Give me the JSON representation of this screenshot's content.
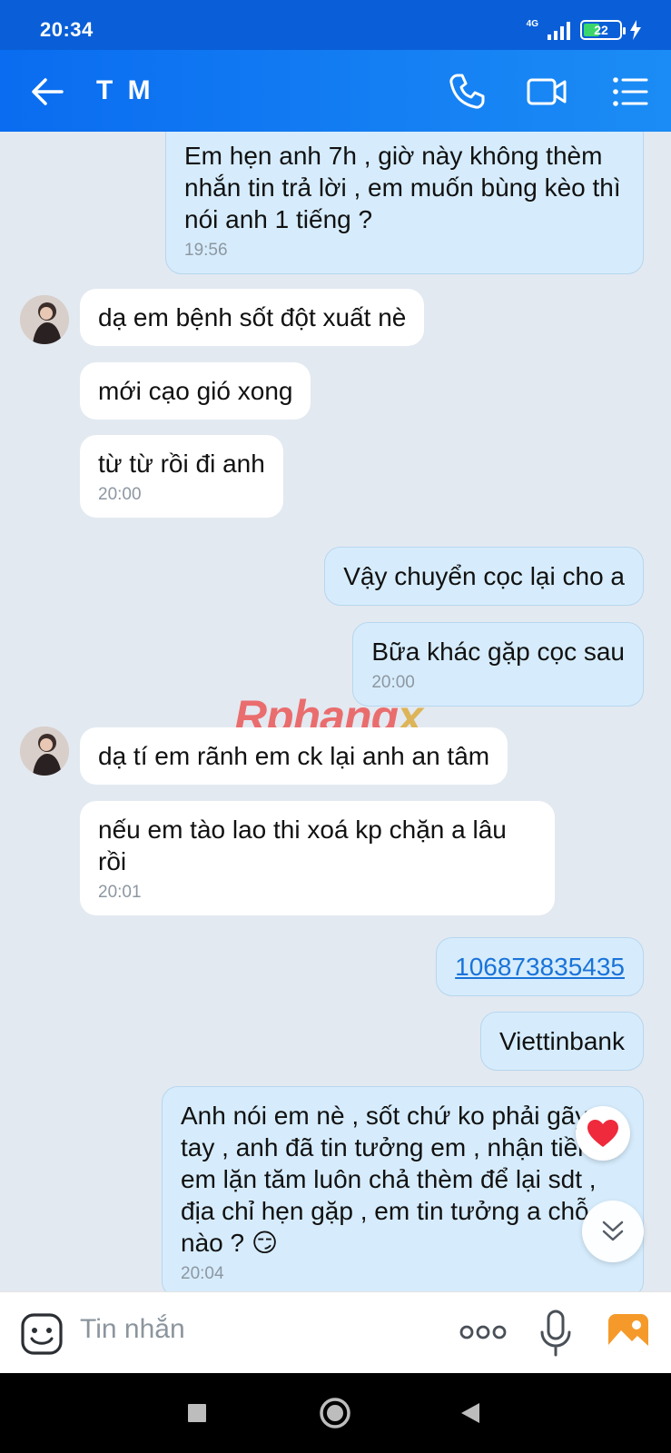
{
  "status_bar": {
    "time": "20:34",
    "network": "4G",
    "battery": "22"
  },
  "header": {
    "contact_name": "T M"
  },
  "messages": [
    {
      "sender": "me",
      "text": "Em hẹn anh 7h , giờ này không thèm nhắn tin trả lời , em muốn bùng kèo thì nói anh 1 tiếng ?",
      "time": "19:56"
    },
    {
      "sender": "them",
      "text": "dạ em bệnh sốt đột xuất nè",
      "time": ""
    },
    {
      "sender": "them",
      "text": "mới cạo gió xong",
      "time": ""
    },
    {
      "sender": "them",
      "text": "từ từ rồi đi anh",
      "time": "20:00"
    },
    {
      "sender": "me",
      "text": "Vậy chuyển cọc lại cho a",
      "time": ""
    },
    {
      "sender": "me",
      "text": "Bữa khác gặp cọc sau",
      "time": "20:00"
    },
    {
      "sender": "them",
      "text": "dạ tí em rãnh em ck lại anh an tâm",
      "time": ""
    },
    {
      "sender": "them",
      "text": "nếu em tào lao thi xoá kp chặn a lâu rồi",
      "time": "20:01"
    },
    {
      "sender": "me",
      "text": "106873835435",
      "time": ""
    },
    {
      "sender": "me",
      "text": "Viettinbank",
      "time": ""
    },
    {
      "sender": "me",
      "text": "Anh nói em nè , sốt chứ ko phải gãy tay , anh đã tin tưởng em , nhận tiền em lặn tăm luôn chả thèm để lại sdt , địa chỉ hẹn gặp , em tin tưởng a chỗ nào ? 😏",
      "time": "20:04"
    }
  ],
  "watermark": {
    "main": "Rphang",
    "accent": "x"
  },
  "input": {
    "placeholder": "Tin nhắn"
  }
}
